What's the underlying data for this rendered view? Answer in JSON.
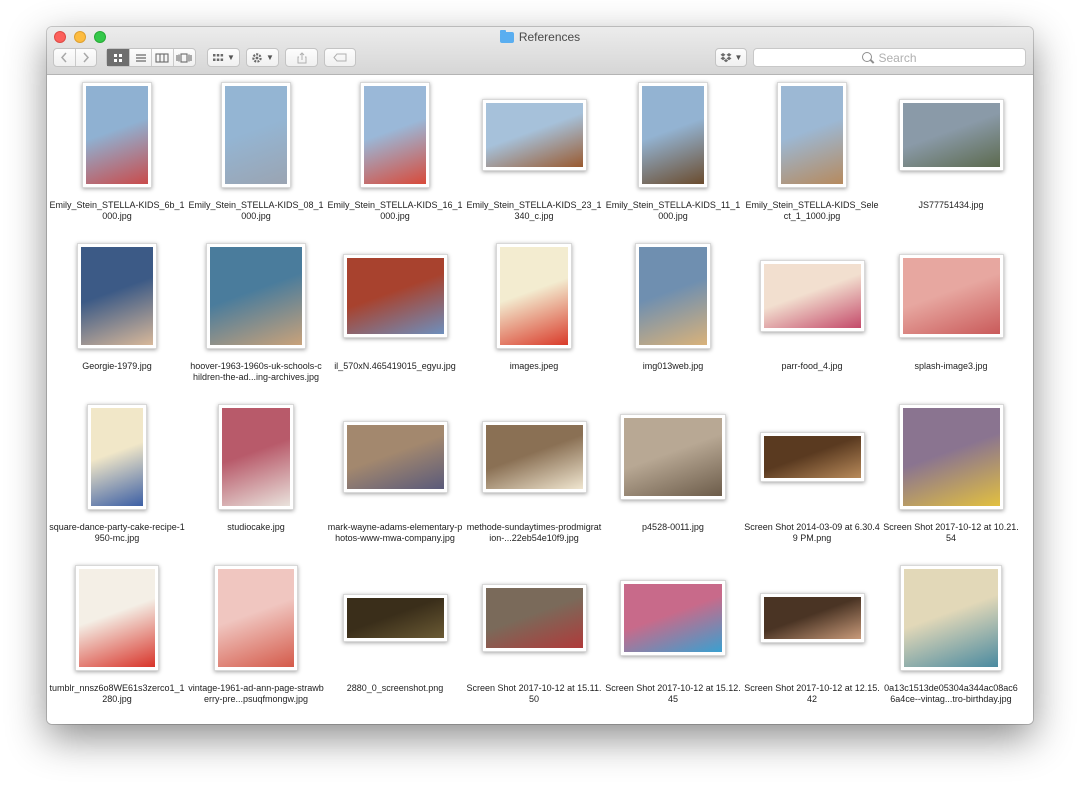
{
  "window": {
    "title": "References",
    "search_placeholder": "Search"
  },
  "toolbar": {
    "back_icon": "chevron-left-icon",
    "forward_icon": "chevron-right-icon",
    "view_icons": [
      "grid-view-icon",
      "list-view-icon",
      "column-view-icon",
      "cover-flow-view-icon"
    ],
    "group_icon": "arrange-grid-icon",
    "action_icon": "gear-icon",
    "share_icon": "share-icon",
    "tag_icon": "tag-icon",
    "dropbox_icon": "dropbox-icon"
  },
  "files": [
    {
      "name": "Emily_Stein_STELLA-KIDS_6b_1000.jpg",
      "colors": [
        "#8fb1d2",
        "#c94b4b"
      ]
    },
    {
      "name": "Emily_Stein_STELLA-KIDS_08_1000.jpg",
      "colors": [
        "#94b5d3",
        "#9aa4b2"
      ]
    },
    {
      "name": "Emily_Stein_STELLA-KIDS_16_1000.jpg",
      "colors": [
        "#9ab8d8",
        "#d84a3a"
      ]
    },
    {
      "name": "Emily_Stein_STELLA-KIDS_23_1340_c.jpg",
      "colors": [
        "#a6c1da",
        "#9a5a30"
      ]
    },
    {
      "name": "Emily_Stein_STELLA-KIDS_11_1000.jpg",
      "colors": [
        "#93b3d2",
        "#6b4c2e"
      ]
    },
    {
      "name": "Emily_Stein_STELLA-KIDS_Select_1_1000.jpg",
      "colors": [
        "#9cb8d4",
        "#b68a5e"
      ]
    },
    {
      "name": "JS77751434.jpg",
      "colors": [
        "#8a9aa8",
        "#5c6a4e"
      ]
    },
    {
      "name": "Georgie-1979.jpg",
      "colors": [
        "#3c5a86",
        "#d8b89a"
      ]
    },
    {
      "name": "hoover-1963-1960s-uk-schools-children-the-ad...ing-archives.jpg",
      "colors": [
        "#4a7c9c",
        "#c9a27a"
      ]
    },
    {
      "name": "il_570xN.465419015_egyu.jpg",
      "colors": [
        "#a8422e",
        "#6e8fbd"
      ]
    },
    {
      "name": "images.jpeg",
      "colors": [
        "#f3ecd0",
        "#d93b2a"
      ]
    },
    {
      "name": "img013web.jpg",
      "colors": [
        "#6f8fb0",
        "#d9b27a"
      ]
    },
    {
      "name": "parr-food_4.jpg",
      "colors": [
        "#f2dfcf",
        "#c44a6a"
      ]
    },
    {
      "name": "splash-image3.jpg",
      "colors": [
        "#e7a7a0",
        "#c95a5a"
      ]
    },
    {
      "name": "square-dance-party-cake-recipe-1950-mc.jpg",
      "colors": [
        "#f1e7c8",
        "#3c5fa5"
      ]
    },
    {
      "name": "studiocake.jpg",
      "colors": [
        "#b85a6a",
        "#e9e2dc"
      ]
    },
    {
      "name": "mark-wayne-adams-elementary-photos-www-mwa-company.jpg",
      "colors": [
        "#a3886e",
        "#5a5a7a"
      ]
    },
    {
      "name": "methode-sundaytimes-prodmigration-...22eb54e10f9.jpg",
      "colors": [
        "#8a7054",
        "#f0e6d0"
      ]
    },
    {
      "name": "p4528-0011.jpg",
      "colors": [
        "#b8a894",
        "#6c5c4a"
      ]
    },
    {
      "name": "Screen Shot 2014-03-09 at 6.30.49 PM.png",
      "colors": [
        "#5a3a20",
        "#b88a5a"
      ]
    },
    {
      "name": "Screen Shot 2017-10-12 at 10.21.54",
      "colors": [
        "#8a7490",
        "#e2c040"
      ]
    },
    {
      "name": "tumblr_nnsz6o8WE61s3zerco1_1280.jpg",
      "colors": [
        "#f4efe6",
        "#d8342a"
      ]
    },
    {
      "name": "vintage-1961-ad-ann-page-strawberry-pre...psuqfmongw.jpg",
      "colors": [
        "#f0c6c0",
        "#d45a4a"
      ]
    },
    {
      "name": "2880_0_screenshot.png",
      "colors": [
        "#3a2e1a",
        "#6a5a34"
      ]
    },
    {
      "name": "Screen Shot 2017-10-12 at 15.11.50",
      "colors": [
        "#7a6a5a",
        "#b03a3a"
      ]
    },
    {
      "name": "Screen Shot 2017-10-12 at 15.12.45",
      "colors": [
        "#c86a8a",
        "#3aa0d0"
      ]
    },
    {
      "name": "Screen Shot 2017-10-12 at 12.15.42",
      "colors": [
        "#4a3424",
        "#c89a7a"
      ]
    },
    {
      "name": "0a13c1513de05304a344ac08ac66a4ce--vintag...tro-birthday.jpg",
      "colors": [
        "#e2d8b8",
        "#4a8aa0"
      ]
    }
  ]
}
